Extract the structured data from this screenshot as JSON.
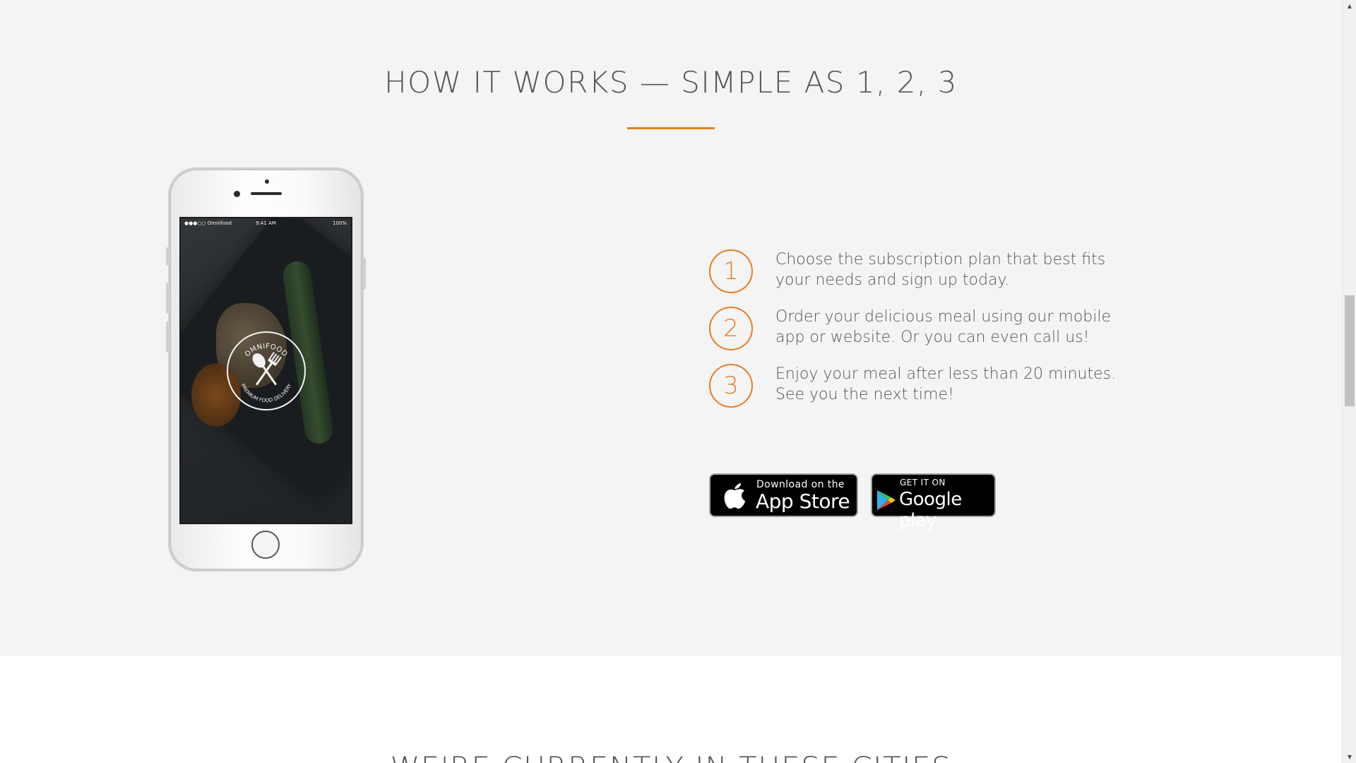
{
  "how_it_works": {
    "title": "HOW IT WORKS — SIMPLE AS 1, 2, 3",
    "steps": [
      {
        "number": "1",
        "text": "Choose the subscription plan that best fits your needs and sign up today."
      },
      {
        "number": "2",
        "text": "Order your delicious meal using our mobile app or website. Or you can even call us!"
      },
      {
        "number": "3",
        "text": "Enjoy your meal after less than 20 minutes. See you the next time!"
      }
    ],
    "phone": {
      "carrier": "●●●○○ Omnifood",
      "time": "9:41 AM",
      "battery": "100%",
      "logo_top_text": "OMNIFOOD",
      "logo_bottom_text": "PREMIUM FOOD DELIVERY"
    },
    "app_store": {
      "small_text": "Download on the",
      "big_text": "App Store"
    },
    "google_play": {
      "small_text": "GET IT ON",
      "big_text": "Google play"
    }
  },
  "cities": {
    "title": "WE'RE CURRENTLY IN THESE CITIES"
  },
  "colors": {
    "accent": "#e67e22",
    "section_bg": "#f4f4f4",
    "text": "#555555"
  }
}
